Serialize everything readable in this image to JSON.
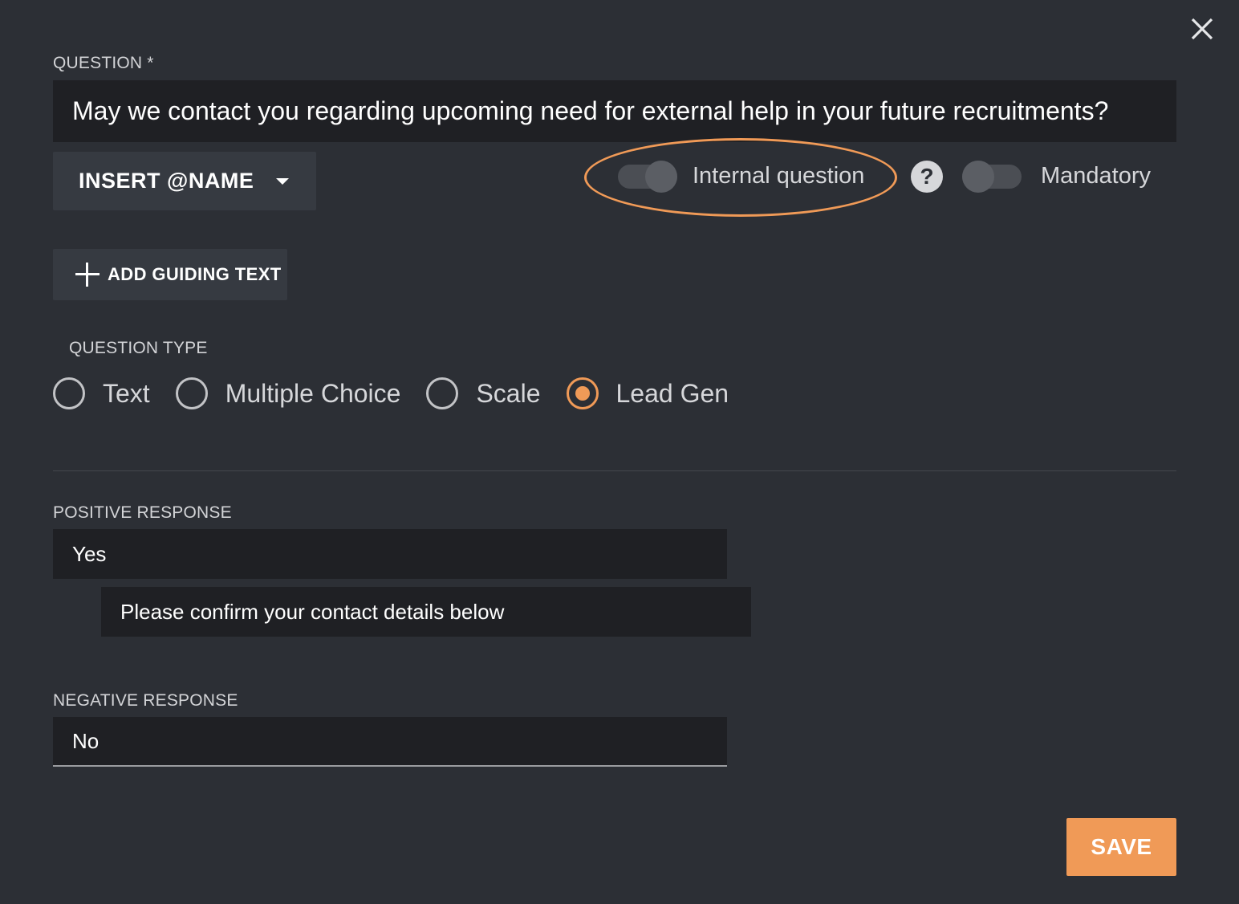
{
  "dialog": {
    "close_icon": "close-icon"
  },
  "question": {
    "label": "QUESTION *",
    "value": "May we contact you regarding upcoming need for external help in your future recruitments?"
  },
  "insert_name": {
    "label": "INSERT @NAME",
    "icon": "caret-down-icon"
  },
  "toggles": {
    "internal_question": {
      "label": "Internal question",
      "on": false
    },
    "help_icon": "?",
    "mandatory": {
      "label": "Mandatory",
      "on": false
    }
  },
  "annotation": {
    "color": "#f09a57"
  },
  "guiding_text": {
    "label": "ADD GUIDING TEXT",
    "icon": "plus-icon"
  },
  "question_type": {
    "label": "QUESTION TYPE",
    "options": [
      {
        "label": "Text",
        "selected": false
      },
      {
        "label": "Multiple Choice",
        "selected": false
      },
      {
        "label": "Scale",
        "selected": false
      },
      {
        "label": "Lead Gen",
        "selected": true
      }
    ]
  },
  "positive_response": {
    "label": "POSITIVE RESPONSE",
    "value": "Yes",
    "follow_up": "Please confirm your contact details below"
  },
  "negative_response": {
    "label": "NEGATIVE RESPONSE",
    "value": "No"
  },
  "actions": {
    "save_label": "SAVE"
  },
  "colors": {
    "background": "#2c2f35",
    "input_bg": "#1f2024",
    "accent": "#f09a57"
  }
}
